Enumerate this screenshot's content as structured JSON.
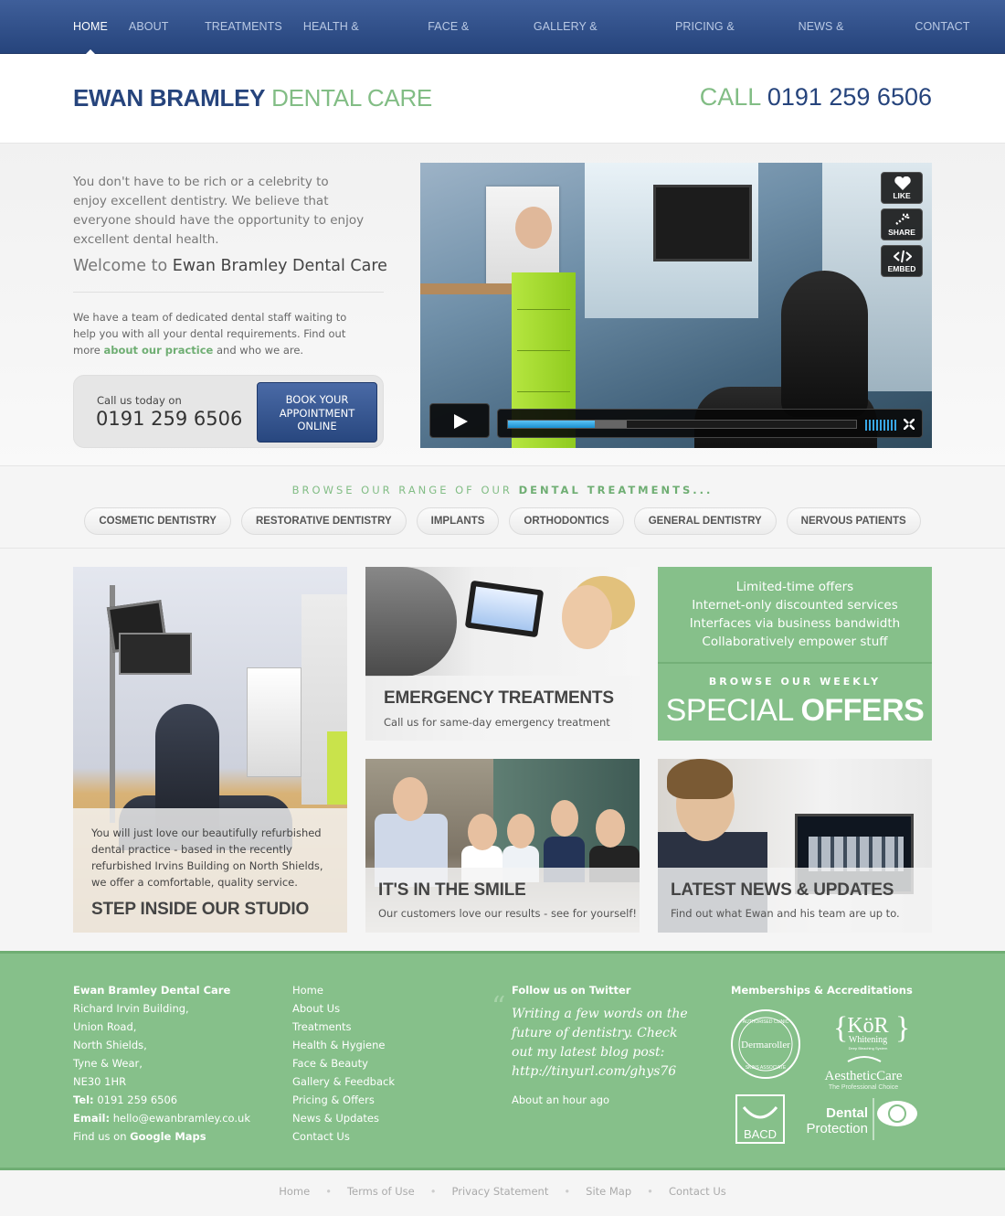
{
  "nav": {
    "items": [
      {
        "label": "HOME"
      },
      {
        "label": "ABOUT US"
      },
      {
        "label": "TREATMENTS"
      },
      {
        "label": "HEALTH & HYGIENE"
      },
      {
        "label": "FACE & BEAUTY"
      },
      {
        "label": "GALLERY & FEEDBACK"
      },
      {
        "label": "PRICING & OFFERS"
      },
      {
        "label": "NEWS & UPDATES"
      },
      {
        "label": "CONTACT US"
      }
    ],
    "active_index": 0
  },
  "header": {
    "logo_part1": "EWAN BRAMLEY",
    "logo_part2": "DENTAL CARE",
    "call_label": "CALL",
    "call_number": "0191 259 6506"
  },
  "intro": {
    "paragraph": "You don't have to be rich or a celebrity to enjoy excellent dentistry. We believe that everyone should have the opportunity to enjoy excellent dental health.",
    "welcome_prefix": "Welcome to",
    "welcome_name": "Ewan Bramley Dental Care",
    "team_text_1": "We have a team of dedicated dental staff waiting to help you with all your dental requirements. Find out more",
    "team_link": "about our practice",
    "team_text_2": "and who we are.",
    "call_label": "Call us today on",
    "call_number": "0191 259 6506",
    "book_line1": "BOOK YOUR",
    "book_line2": "APPOINTMENT",
    "book_line3": "ONLINE"
  },
  "video": {
    "like_label": "LIKE",
    "share_label": "SHARE",
    "embed_label": "EMBED",
    "progress_fraction": 0.25,
    "buffered_fraction": 0.34
  },
  "browse": {
    "prefix": "BROWSE OUR RANGE OF OUR",
    "highlight": "DENTAL TREATMENTS...",
    "pills": [
      {
        "label": "COSMETIC DENTISTRY"
      },
      {
        "label": "RESTORATIVE DENTISTRY"
      },
      {
        "label": "IMPLANTS"
      },
      {
        "label": "ORTHODONTICS"
      },
      {
        "label": "GENERAL DENTISTRY"
      },
      {
        "label": "NERVOUS PATIENTS"
      }
    ]
  },
  "tiles": {
    "studio": {
      "desc": "You will just love our beautifully refurbished dental practice - based in the recently refurbished Irvins Building on North Shields, we offer a comfortable, quality service.",
      "title": "STEP INSIDE OUR STUDIO"
    },
    "emergency": {
      "title": "EMERGENCY TREATMENTS",
      "sub": "Call us for same-day emergency treatment"
    },
    "offers": {
      "lines": [
        "Limited-time offers",
        "Internet-only discounted services",
        "Interfaces via business bandwidth",
        "Collaboratively empower stuff"
      ],
      "kicker": "BROWSE OUR WEEKLY",
      "big_light": "SPECIAL",
      "big_bold": "OFFERS"
    },
    "smile": {
      "title": "IT'S IN THE SMILE",
      "sub": "Our customers love our results - see for yourself!"
    },
    "news": {
      "title": "LATEST NEWS & UPDATES",
      "sub": "Find out what Ewan and his team are up to."
    }
  },
  "footer": {
    "address": {
      "name": "Ewan Bramley Dental Care",
      "lines": [
        "Richard Irvin Building,",
        "Union Road,",
        "North Shields,",
        "Tyne & Wear,",
        "NE30 1HR"
      ],
      "tel_label": "Tel:",
      "tel": "0191 259 6506",
      "email_label": "Email:",
      "email": "hello@ewanbramley.co.uk",
      "maps_prefix": "Find us on",
      "maps_link": "Google Maps"
    },
    "links": [
      {
        "label": "Home"
      },
      {
        "label": "About Us"
      },
      {
        "label": "Treatments"
      },
      {
        "label": "Health & Hygiene"
      },
      {
        "label": "Face & Beauty"
      },
      {
        "label": "Gallery & Feedback"
      },
      {
        "label": "Pricing & Offers"
      },
      {
        "label": "News & Updates"
      },
      {
        "label": "Contact Us"
      }
    ],
    "twitter": {
      "heading": "Follow us on Twitter",
      "tweet": "Writing a few words on the future of dentistry. Check out my latest blog post: http://tinyurl.com/ghys76",
      "time": "About an hour ago"
    },
    "memberships": {
      "heading": "Memberships & Accreditations",
      "dermaroller": "Dermaroller",
      "dermaroller_ring_top": "AUTHORISED CLINIC",
      "dermaroller_ring_bottom": "SKINS ASSOCIATE",
      "kor": "KöR",
      "kor_sub": "Whitening",
      "kor_tag": "Deep Bleaching System",
      "aesthetic": "AestheticCare",
      "aesthetic_sub": "The Professional Choice",
      "bacd": "BACD",
      "dp1": "Dental",
      "dp2": "Protection"
    }
  },
  "bottom_links": [
    {
      "label": "Home"
    },
    {
      "label": "Terms of Use"
    },
    {
      "label": "Privacy Statement"
    },
    {
      "label": "Site Map"
    },
    {
      "label": "Contact Us"
    }
  ],
  "colors": {
    "brand_blue": "#26447c",
    "brand_green": "#82bd85",
    "footer_green": "#86c08a"
  }
}
